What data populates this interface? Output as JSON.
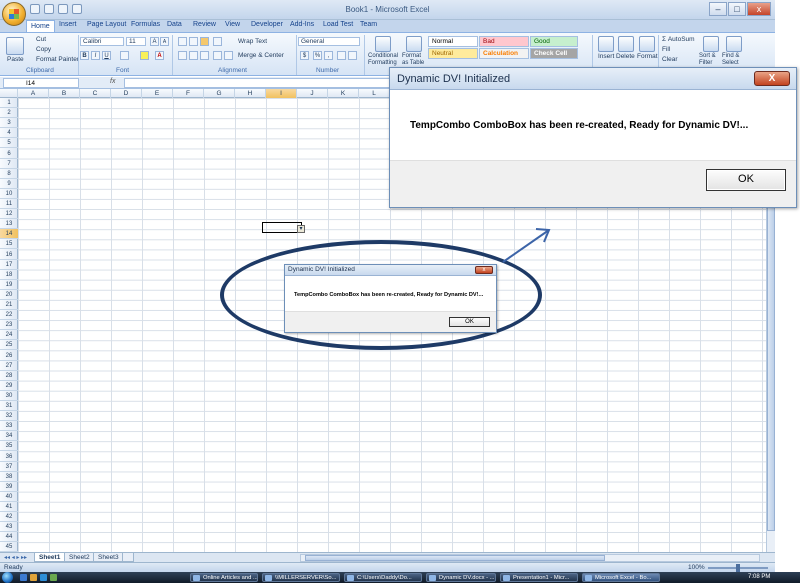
{
  "window": {
    "title": "Book1 - Microsoft Excel",
    "minimize": "–",
    "maximize": "□",
    "close": "x"
  },
  "tabs": [
    "Home",
    "Insert",
    "Page Layout",
    "Formulas",
    "Data",
    "Review",
    "View",
    "Developer",
    "Add-Ins",
    "Load Test",
    "Team"
  ],
  "ribbon": {
    "clipboard": {
      "paste": "Paste",
      "cut": "Cut",
      "copy": "Copy",
      "format_painter": "Format Painter",
      "label": "Clipboard"
    },
    "font": {
      "name": "Calibri",
      "size": "11",
      "bold": "B",
      "italic": "I",
      "underline": "U",
      "grow": "A",
      "shrink": "A",
      "label": "Font"
    },
    "alignment": {
      "wrap": "Wrap Text",
      "merge": "Merge & Center",
      "label": "Alignment"
    },
    "number": {
      "format": "General",
      "currency": "$",
      "percent": "%",
      "comma": ",",
      "label": "Number"
    },
    "styles": {
      "conditional": "Conditional Formatting",
      "format_table": "Format as Table",
      "normal": "Normal",
      "bad": "Bad",
      "good": "Good",
      "neutral": "Neutral",
      "calculation": "Calculation",
      "check_cell": "Check Cell"
    },
    "cells": {
      "insert": "Insert",
      "delete": "Delete",
      "format": "Format"
    },
    "editing": {
      "autosum": "AutoSum",
      "fill": "Fill",
      "clear": "Clear",
      "sort_filter": "Sort & Filter",
      "find_select": "Find & Select"
    }
  },
  "formula_bar": {
    "name_box": "I14",
    "fx": "fx",
    "value": ""
  },
  "grid": {
    "columns": [
      "A",
      "B",
      "C",
      "D",
      "E",
      "F",
      "G",
      "H",
      "I",
      "J",
      "K",
      "L"
    ],
    "selected_column": "I",
    "rows": [
      "1",
      "2",
      "3",
      "4",
      "5",
      "6",
      "7",
      "8",
      "9",
      "10",
      "11",
      "12",
      "13",
      "14",
      "15",
      "16",
      "17",
      "18",
      "19",
      "20",
      "21",
      "22",
      "23",
      "24",
      "25",
      "26",
      "27",
      "28",
      "29",
      "30",
      "31",
      "32",
      "33",
      "34",
      "35",
      "36",
      "37",
      "38",
      "39",
      "40",
      "41",
      "42",
      "43",
      "44",
      "45"
    ],
    "selected_row": "14",
    "combo_arrow": "▾"
  },
  "sheets": [
    "Sheet1",
    "Sheet2",
    "Sheet3"
  ],
  "active_sheet": "Sheet1",
  "status": {
    "ready": "Ready",
    "zoom": "100%"
  },
  "dialog_big": {
    "title": "Dynamic DV! Initialized",
    "close": "X",
    "message": "TempCombo ComboBox has been re-created, Ready for Dynamic DV!...",
    "ok": "OK"
  },
  "dialog_small": {
    "title": "Dynamic DV! Initialized",
    "close": "x",
    "message": "TempCombo ComboBox has been re-created, Ready for Dynamic DV!...",
    "ok": "OK"
  },
  "taskbar": {
    "items": [
      "Online Articles and ...",
      "\\\\MILLERSERVER\\So...",
      "C:\\Users\\Daddy\\Do...",
      "Dynamic DV.docx - ...",
      "Presentation1 - Micr...",
      "Microsoft Excel - Bo..."
    ],
    "active": "Microsoft Excel - Bo...",
    "clock": "7:08 PM"
  },
  "colors": {
    "accent": "#1e3a66",
    "ribbon": "#d6e4f5",
    "selected_header": "#f1c15f"
  }
}
